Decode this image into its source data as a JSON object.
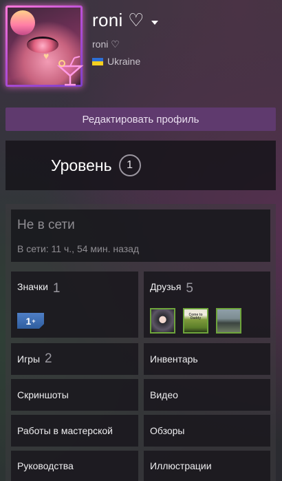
{
  "colors": {
    "accent": "#5f3a6e",
    "online_frame": "#6ea53b",
    "avatar_glow": "#ff6edc"
  },
  "profile": {
    "username": "roni ♡",
    "real_name": "roni ♡",
    "country": "Ukraine",
    "avatar_icon": "cocktail-icon",
    "flag_icon": "ukraine-flag-icon"
  },
  "actions": {
    "edit_profile": "Редактировать профиль"
  },
  "level": {
    "label": "Уровень",
    "value": "1"
  },
  "status": {
    "title": "Не в сети",
    "last_seen": "В сети: 11 ч., 54 мин. назад"
  },
  "sections": {
    "badges": {
      "label": "Значки",
      "count": "1",
      "badge_text": "1",
      "badge_sup": "+"
    },
    "friends": {
      "label": "Друзья",
      "count": "5",
      "avatar2_caption": "Come to Daddy"
    },
    "games": {
      "label": "Игры",
      "count": "2"
    },
    "inventory": {
      "label": "Инвентарь"
    },
    "screenshots": {
      "label": "Скриншоты"
    },
    "videos": {
      "label": "Видео"
    },
    "workshop": {
      "label": "Работы в мастерской"
    },
    "reviews": {
      "label": "Обзоры"
    },
    "guides": {
      "label": "Руководства"
    },
    "artwork": {
      "label": "Иллюстрации"
    }
  }
}
